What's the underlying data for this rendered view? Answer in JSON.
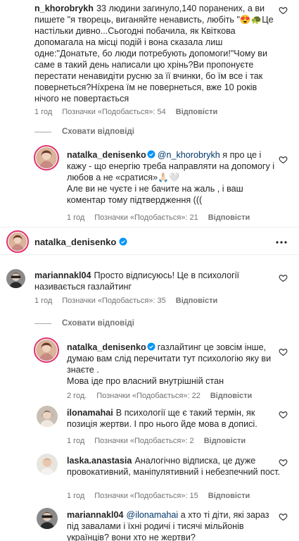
{
  "comments": [
    {
      "username": "n_khorobrykh",
      "text": "33 людини загинуло,140 поранених, а ви пишете \"я творець, виганяйте ненависть, любіть \"😍🐢Це настільки дивно...Сьогодні побачила, як Квіткова допомагала на місці подій і вона сказала лиш одне:\"Донатьте, бо люди потребують допомоги!\"Чому ви саме в такий день написали цю хрінь?Ви пропонуєте перестати ненавидіти русню за її вчинки, бо їм все і так повернеться?Нíхрена їм не повернеться, вже 10 років нічого не повертається",
      "time": "1 год",
      "likes": "Позначки «Подобається»: 54",
      "reply": "Відповісти"
    },
    {
      "username": "natalka_denisenko",
      "mention": "@n_khorobrykh",
      "text": "я про це і кажу - що енергію треба направляти на допомогу і любов а не «сратися»🙏🏻🤍\nАле ви не чуєте і не бачите на жаль , і ваш коментар тому підтвердження (((",
      "time": "1 год",
      "likes": "Позначки «Подобається»: 21",
      "reply": "Відповісти"
    },
    {
      "username": "mariannakl04",
      "text": "Просто відписуюсь! Це в психології називається газлайтинг",
      "time": "1 год",
      "likes": "Позначки «Подобається»: 35",
      "reply": "Відповісти"
    },
    {
      "username": "natalka_denisenko",
      "text": "газлайтинг це зовсім інше, думаю вам слід перечитати тут психологію яку ви знаєте .\nМова іде про власний внутрішній стан",
      "time": "2 год.",
      "likes": "Позначки «Подобається»: 22",
      "reply": "Відповісти"
    },
    {
      "username": "ilonamahai",
      "text": "В психології ще є такий термін, як позиція жертви. І про нього йде мова в дописі.",
      "time": "1 год",
      "likes": "Позначки «Подобається»: 2",
      "reply": "Відповісти"
    },
    {
      "username": "laska.anastasia",
      "text": "Аналогічно відписка, це дуже провокативний, маніпулятивний і небезпечний пост.",
      "time": "1 год",
      "likes": "Позначки «Подобається»: 15",
      "reply": "Відповісти"
    },
    {
      "username": "mariannakl04",
      "mention": "@ilonamahai",
      "text": "а хто ті діти, які зараз під завалами і їхні родичі і тисячі мільйонів українців? вони хто не жертви?"
    }
  ],
  "hide_replies": [
    "Сховати відповіді",
    "Сховати відповіді"
  ],
  "owner": {
    "username": "natalka_denisenko"
  },
  "colors": {
    "verified": "#0095f6",
    "link": "#00376b",
    "meta": "#737373"
  },
  "icons": [
    "heart-icon",
    "verified-badge-icon",
    "more-options-icon"
  ]
}
